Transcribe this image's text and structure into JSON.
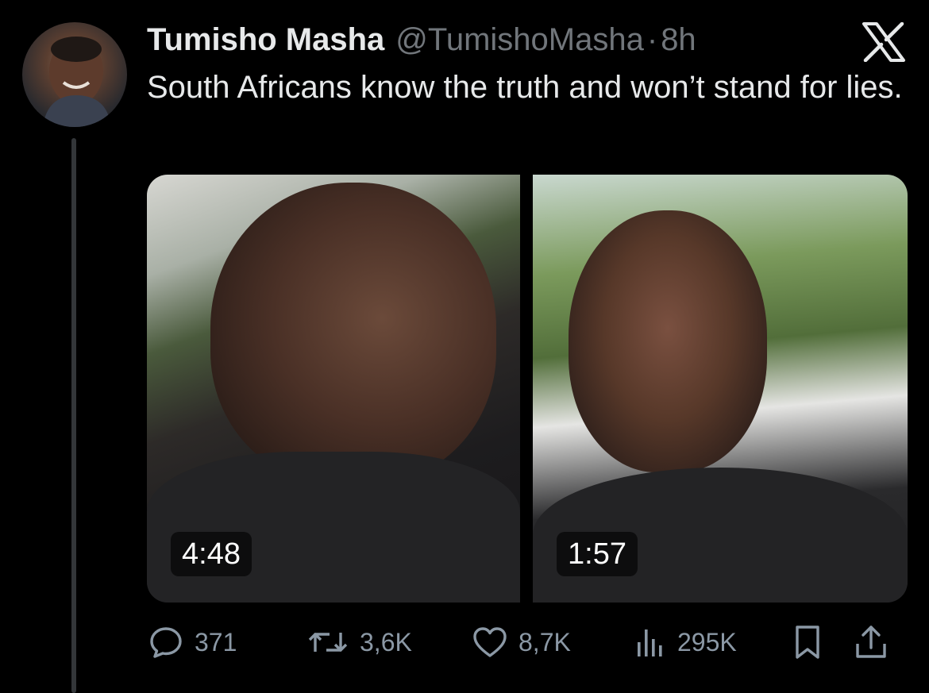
{
  "tweet": {
    "author_name": "Tumisho Masha",
    "handle": "@TumishoMasha",
    "separator": "·",
    "time": "8h",
    "text": "South Africans know the truth and won’t stand for lies."
  },
  "media": {
    "videos": [
      {
        "duration": "4:48"
      },
      {
        "duration": "1:57"
      }
    ]
  },
  "actions": {
    "replies": "371",
    "reposts": "3,6K",
    "likes": "8,7K",
    "views": "295K"
  },
  "icons": {
    "brand": "x-logo-icon",
    "reply": "reply-icon",
    "repost": "repost-icon",
    "like": "heart-icon",
    "views": "views-icon",
    "bookmark": "bookmark-icon",
    "share": "share-icon"
  },
  "colors": {
    "background": "#000000",
    "text": "#e7e9ea",
    "muted": "#71767b",
    "thread_line": "#333639"
  }
}
